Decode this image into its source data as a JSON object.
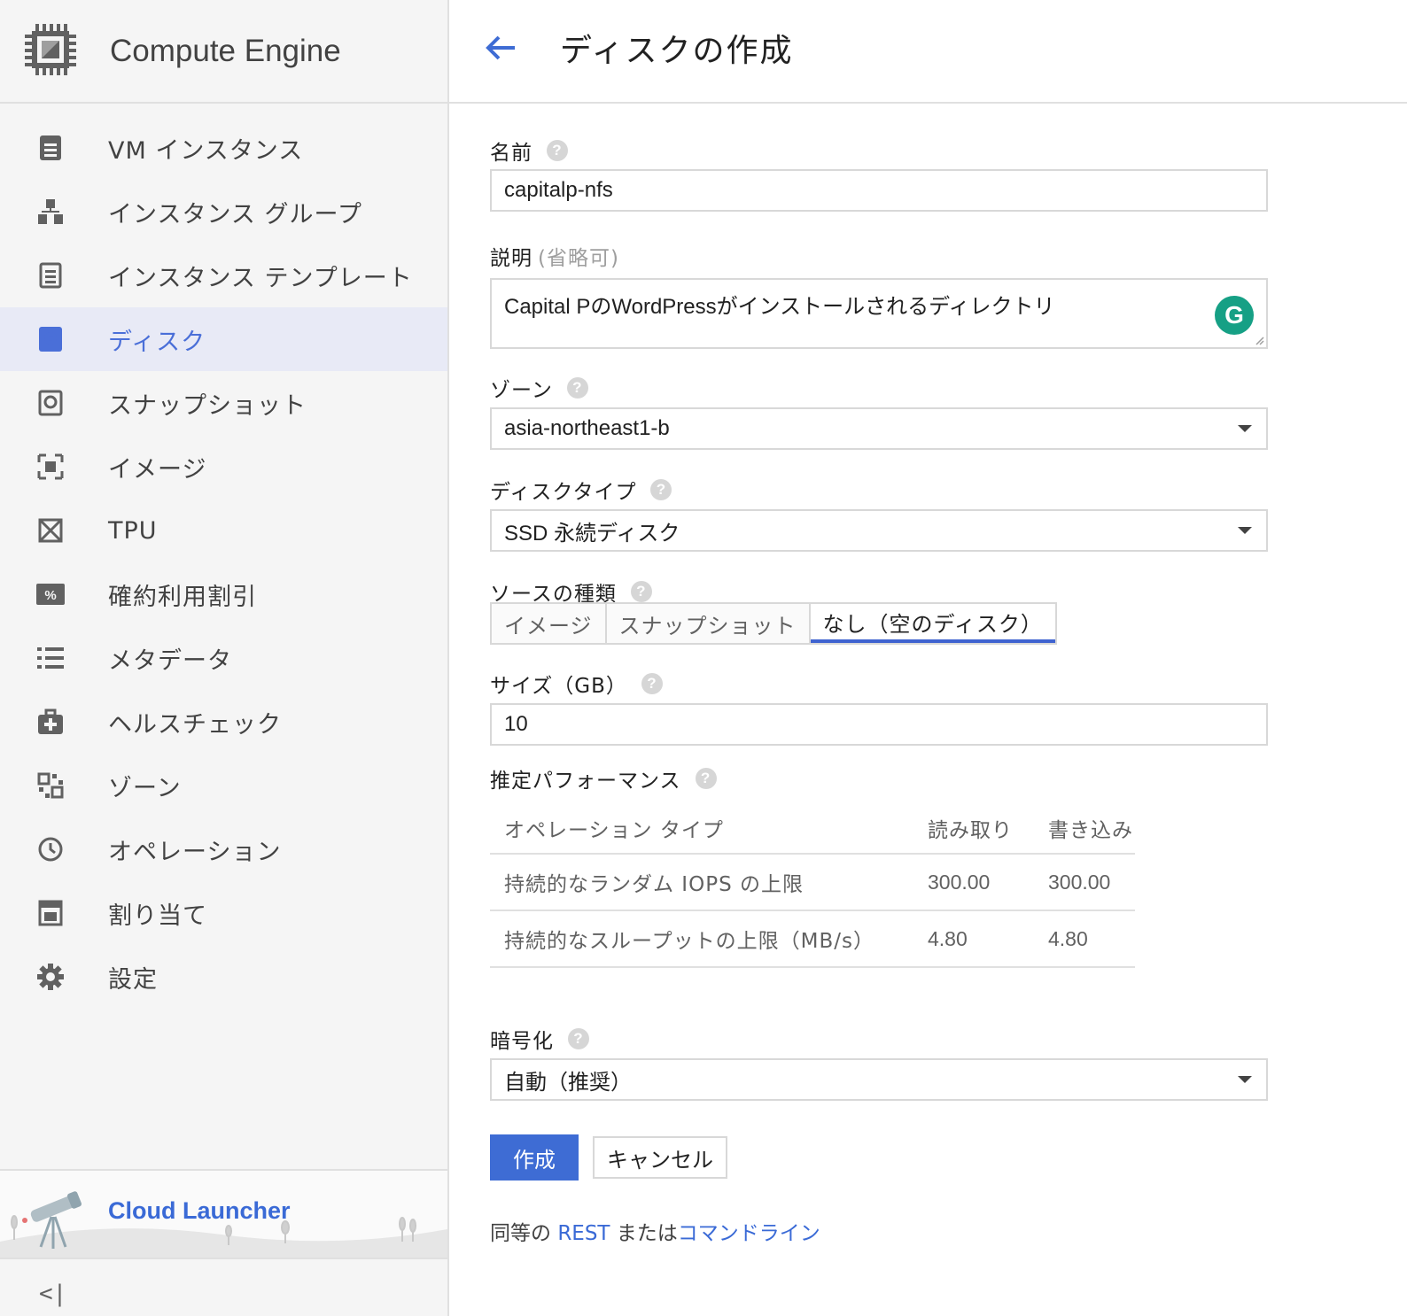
{
  "sidebar": {
    "app_title": "Compute Engine",
    "items": [
      {
        "label": "VM インスタンス",
        "icon": "vm-instance-icon"
      },
      {
        "label": "インスタンス グループ",
        "icon": "instance-group-icon"
      },
      {
        "label": "インスタンス テンプレート",
        "icon": "instance-template-icon"
      },
      {
        "label": "ディスク",
        "icon": "disk-icon",
        "active": true
      },
      {
        "label": "スナップショット",
        "icon": "snapshot-icon"
      },
      {
        "label": "イメージ",
        "icon": "image-icon"
      },
      {
        "label": "TPU",
        "icon": "tpu-icon"
      },
      {
        "label": "確約利用割引",
        "icon": "discount-icon"
      },
      {
        "label": "メタデータ",
        "icon": "metadata-icon"
      },
      {
        "label": "ヘルスチェック",
        "icon": "health-check-icon"
      },
      {
        "label": "ゾーン",
        "icon": "zone-icon"
      },
      {
        "label": "オペレーション",
        "icon": "operations-icon"
      },
      {
        "label": "割り当て",
        "icon": "quota-icon"
      },
      {
        "label": "設定",
        "icon": "settings-icon"
      }
    ],
    "launcher_label": "Cloud Launcher",
    "collapse_glyph": "<|"
  },
  "header": {
    "title": "ディスクの作成"
  },
  "form": {
    "name_label": "名前",
    "name_value": "capitalp-nfs",
    "desc_label": "説明",
    "desc_optional": "(省略可)",
    "desc_value": "Capital PのWordPressがインストールされるディレクトリ",
    "grammarly_glyph": "G",
    "zone_label": "ゾーン",
    "zone_value": "asia-northeast1-b",
    "disk_type_label": "ディスクタイプ",
    "disk_type_value": "SSD 永続ディスク",
    "source_label": "ソースの種類",
    "source_options": [
      "イメージ",
      "スナップショット",
      "なし（空のディスク）"
    ],
    "source_selected": "なし（空のディスク）",
    "size_label": "サイズ（GB）",
    "size_value": "10",
    "perf_label": "推定パフォーマンス",
    "perf_table": {
      "headers": [
        "オペレーション タイプ",
        "読み取り",
        "書き込み"
      ],
      "rows": [
        [
          "持続的なランダム IOPS の上限",
          "300.00",
          "300.00"
        ],
        [
          "持続的なスループットの上限（MB/s）",
          "4.80",
          "4.80"
        ]
      ]
    },
    "encryption_label": "暗号化",
    "encryption_value": "自動（推奨）",
    "help_glyph": "?"
  },
  "actions": {
    "create_label": "作成",
    "cancel_label": "キャンセル"
  },
  "footer": {
    "equiv_prefix": "同等の ",
    "rest_link": "REST",
    "equiv_middle": " または",
    "cmd_link": "コマンドライン"
  },
  "colors": {
    "accent": "#3e6cd4",
    "active_bg": "#e8eaf6"
  }
}
